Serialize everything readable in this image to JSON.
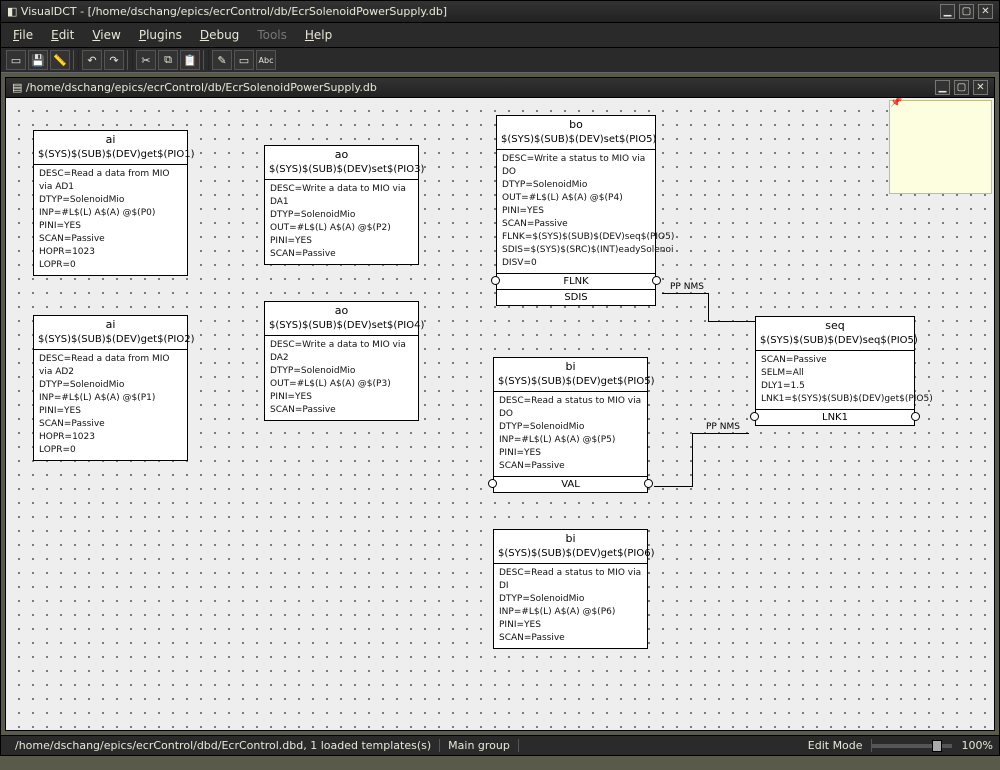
{
  "outerTitle": "VisualDCT - [/home/dschang/epics/ecrControl/db/EcrSolenoidPowerSupply.db]",
  "menus": {
    "file": "File",
    "edit": "Edit",
    "view": "View",
    "plugins": "Plugins",
    "debug": "Debug",
    "tools": "Tools",
    "help": "Help"
  },
  "innerTitle": "/home/dschang/epics/ecrControl/db/EcrSolenoidPowerSupply.db",
  "status": {
    "path": "/home/dschang/epics/ecrControl/dbd/EcrControl.dbd, 1 loaded templates(s)",
    "group": "Main group",
    "mode": "Edit Mode",
    "zoom": "100%"
  },
  "linkLabels": {
    "ppnms1": "PP NMS",
    "ppnms2": "PP NMS"
  },
  "blocks": {
    "ai1": {
      "type": "ai",
      "name": "$(SYS)$(SUB)$(DEV)get$(PIO1)",
      "fields": [
        "DESC=Read a data from MIO via AD1",
        "DTYP=SolenoidMio",
        "INP=#L$(L) A$(A) @$(P0)",
        "PINI=YES",
        "SCAN=Passive",
        "HOPR=1023",
        "LOPR=0"
      ]
    },
    "ai2": {
      "type": "ai",
      "name": "$(SYS)$(SUB)$(DEV)get$(PIO2)",
      "fields": [
        "DESC=Read a data from MIO via AD2",
        "DTYP=SolenoidMio",
        "INP=#L$(L) A$(A) @$(P1)",
        "PINI=YES",
        "SCAN=Passive",
        "HOPR=1023",
        "LOPR=0"
      ]
    },
    "ao1": {
      "type": "ao",
      "name": "$(SYS)$(SUB)$(DEV)set$(PIO3)",
      "fields": [
        "DESC=Write a data to MIO via DA1",
        "DTYP=SolenoidMio",
        "OUT=#L$(L) A$(A) @$(P2)",
        "PINI=YES",
        "SCAN=Passive"
      ]
    },
    "ao2": {
      "type": "ao",
      "name": "$(SYS)$(SUB)$(DEV)set$(PIO4)",
      "fields": [
        "DESC=Write a data to MIO via DA2",
        "DTYP=SolenoidMio",
        "OUT=#L$(L) A$(A) @$(P3)",
        "PINI=YES",
        "SCAN=Passive"
      ]
    },
    "bo1": {
      "type": "bo",
      "name": "$(SYS)$(SUB)$(DEV)set$(PIO5)",
      "fields": [
        "DESC=Write a status to MIO via DO",
        "DTYP=SolenoidMio",
        "OUT=#L$(L) A$(A) @$(P4)",
        "PINI=YES",
        "SCAN=Passive",
        "FLNK=$(SYS)$(SUB)$(DEV)seq$(PIO5)",
        "SDIS=$(SYS)$(SRC)$(INT)eadySolenoi",
        "DISV=0"
      ],
      "ports": [
        "FLNK",
        "SDIS"
      ]
    },
    "bi1": {
      "type": "bi",
      "name": "$(SYS)$(SUB)$(DEV)get$(PIO5)",
      "fields": [
        "DESC=Read a status to MIO via DO",
        "DTYP=SolenoidMio",
        "INP=#L$(L) A$(A) @$(P5)",
        "PINI=YES",
        "SCAN=Passive"
      ],
      "ports": [
        "VAL"
      ]
    },
    "bi2": {
      "type": "bi",
      "name": "$(SYS)$(SUB)$(DEV)get$(PIO6)",
      "fields": [
        "DESC=Read a status to MIO via DI",
        "DTYP=SolenoidMio",
        "INP=#L$(L) A$(A) @$(P6)",
        "PINI=YES",
        "SCAN=Passive"
      ]
    },
    "seq1": {
      "type": "seq",
      "name": "$(SYS)$(SUB)$(DEV)seq$(PIO5)",
      "fields": [
        "SCAN=Passive",
        "SELM=All",
        "DLY1=1.5",
        "LNK1=$(SYS)$(SUB)$(DEV)get$(PIO5)"
      ],
      "ports": [
        "LNK1"
      ]
    }
  }
}
